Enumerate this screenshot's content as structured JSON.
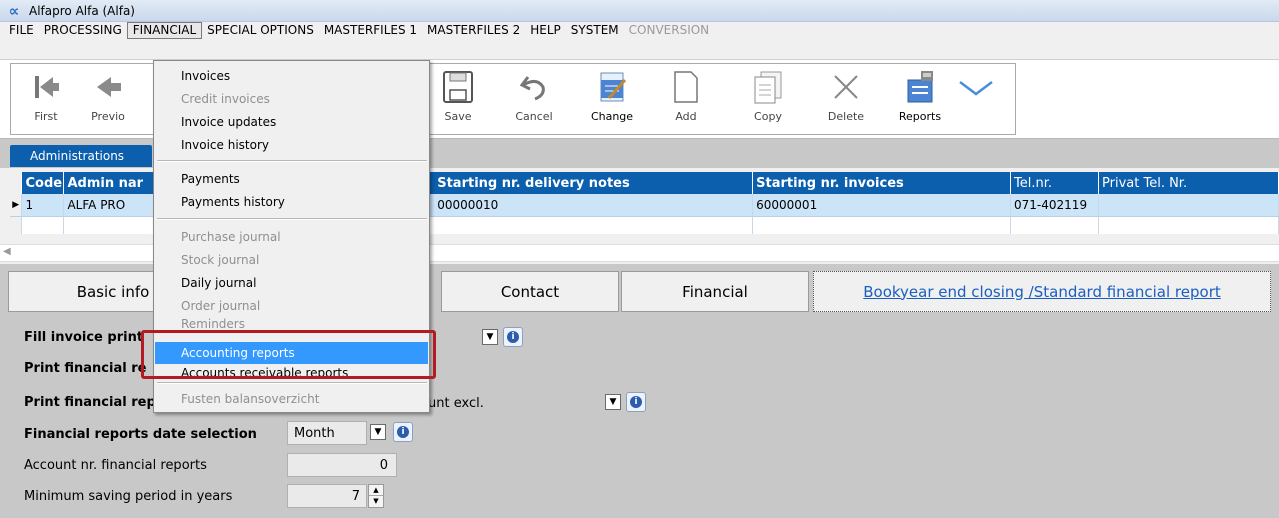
{
  "window": {
    "title": "Alfapro Alfa (Alfa)",
    "logo": "∝"
  },
  "menubar": {
    "items": [
      {
        "label": "FILE"
      },
      {
        "label": "PROCESSING"
      },
      {
        "label": "FINANCIAL"
      },
      {
        "label": "SPECIAL OPTIONS"
      },
      {
        "label": "MASTERFILES 1"
      },
      {
        "label": "MASTERFILES 2"
      },
      {
        "label": "HELP"
      },
      {
        "label": "SYSTEM"
      },
      {
        "label": "CONVERSION"
      }
    ],
    "active": "FINANCIAL"
  },
  "toolbar": {
    "first": "First",
    "previous": "Previo",
    "save": "Save",
    "cancel": "Cancel",
    "change": "Change",
    "add": "Add",
    "copy": "Copy",
    "delete": "Delete",
    "reports": "Reports"
  },
  "admin_tab": "Administrations",
  "grid": {
    "columns": [
      "Code",
      "Admin nar",
      "Starting nr. delivery notes",
      "Starting nr. invoices",
      "Tel.nr.",
      "Privat Tel. Nr."
    ],
    "rows": [
      {
        "indicator": "▶",
        "code": "1",
        "admin": "ALFA PRO",
        "delivery": "00000010",
        "invoices": "60000001",
        "tel": "071-402119",
        "privtel": ""
      }
    ],
    "scroll_arrow": "◀"
  },
  "tabs": {
    "basic": "Basic info",
    "contact": "Contact",
    "financial": "Financial",
    "bookyear": "Bookyear end closing /Standard financial report"
  },
  "fields": {
    "fill_invoice": "Fill invoice print",
    "print_fin_1": "Print financial re",
    "print_fin_2": "Print financial rep",
    "print_fin_2_value": "unt excl.",
    "date_selection_label": "Financial reports date selection",
    "date_selection_value": "Month",
    "account_nr_label": "Account nr. financial reports",
    "account_nr_value": "0",
    "min_saving_label": "Minimum saving period in years",
    "min_saving_value": "7"
  },
  "dropdown": {
    "items": [
      {
        "label": "Invoices",
        "disabled": false
      },
      {
        "label": "Credit invoices",
        "disabled": true
      },
      {
        "label": "Invoice updates",
        "disabled": false
      },
      {
        "label": "Invoice history",
        "disabled": false
      },
      {
        "label": "Payments",
        "disabled": false
      },
      {
        "label": "Payments history",
        "disabled": false
      },
      {
        "label": "Purchase journal",
        "disabled": true
      },
      {
        "label": "Stock journal",
        "disabled": true
      },
      {
        "label": "Daily journal",
        "disabled": false
      },
      {
        "label": "Order journal",
        "disabled": true
      },
      {
        "label": "Reminders",
        "disabled": true
      },
      {
        "label": "Accounting reports",
        "disabled": false,
        "highlighted": true
      },
      {
        "label": "Accounts receivable reports",
        "disabled": false
      },
      {
        "label": "Fusten balansoverzicht",
        "disabled": true
      }
    ]
  },
  "colors": {
    "accent": "#0b5fad",
    "highlight": "#3399ff",
    "callout": "#b51a22",
    "link": "#1a5fbf"
  }
}
